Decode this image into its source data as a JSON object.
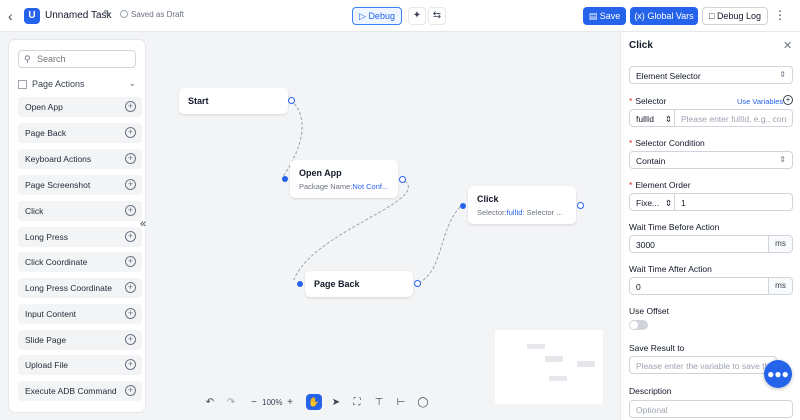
{
  "header": {
    "task_name": "Unnamed Task",
    "logo_letter": "U",
    "saved_status": "Saved as Draft",
    "debug_label": "Debug",
    "save_label": "Save",
    "global_vars_label": "Global Vars",
    "debug_log_label": "Debug Log"
  },
  "sidebar": {
    "search_placeholder": "Search",
    "section_title": "Page Actions",
    "items": [
      {
        "label": "Open App"
      },
      {
        "label": "Page Back"
      },
      {
        "label": "Keyboard Actions"
      },
      {
        "label": "Page Screenshot"
      },
      {
        "label": "Click"
      },
      {
        "label": "Long Press"
      },
      {
        "label": "Click Coordinate"
      },
      {
        "label": "Long Press Coordinate"
      },
      {
        "label": "Input Content"
      },
      {
        "label": "Slide Page"
      },
      {
        "label": "Upload File"
      },
      {
        "label": "Execute ADB Command"
      }
    ]
  },
  "canvas": {
    "nodes": {
      "start": {
        "title": "Start"
      },
      "open_app": {
        "title": "Open App",
        "sub_key": "Package Name:",
        "sub_val": "Not Conf..."
      },
      "click": {
        "title": "Click",
        "sub_key": "Selector:",
        "sub_val": "fullId:",
        "sub_rest": "Selector ..."
      },
      "page_back": {
        "title": "Page Back"
      }
    },
    "zoom": "100%"
  },
  "panel": {
    "title": "Click",
    "type_select": "Element Selector",
    "selector_label": "Selector",
    "use_variables": "Use Variables",
    "selector_type": "fullId",
    "selector_placeholder": "Please enter fullId, e.g., con",
    "condition_label": "Selector Condition",
    "condition_value": "Contain",
    "order_label": "Element Order",
    "order_type": "Fixe...",
    "order_value": "1",
    "wait_before_label": "Wait Time Before Action",
    "wait_before_value": "3000",
    "wait_before_unit": "ms",
    "wait_after_label": "Wait Time After Action",
    "wait_after_value": "0",
    "wait_after_unit": "ms",
    "offset_label": "Use Offset",
    "save_result_label": "Save Result to",
    "save_result_placeholder": "Please enter the variable to save th",
    "description_label": "Description",
    "description_placeholder": "Optional"
  },
  "icons": {
    "back": "chevron-left-icon",
    "edit": "pencil-icon",
    "saved": "info-circle-icon",
    "chat": "chat-bubble-icon"
  },
  "colors": {
    "accent": "#2563eb",
    "required": "#dc2626",
    "canvas_bg": "#f3f4f6"
  }
}
